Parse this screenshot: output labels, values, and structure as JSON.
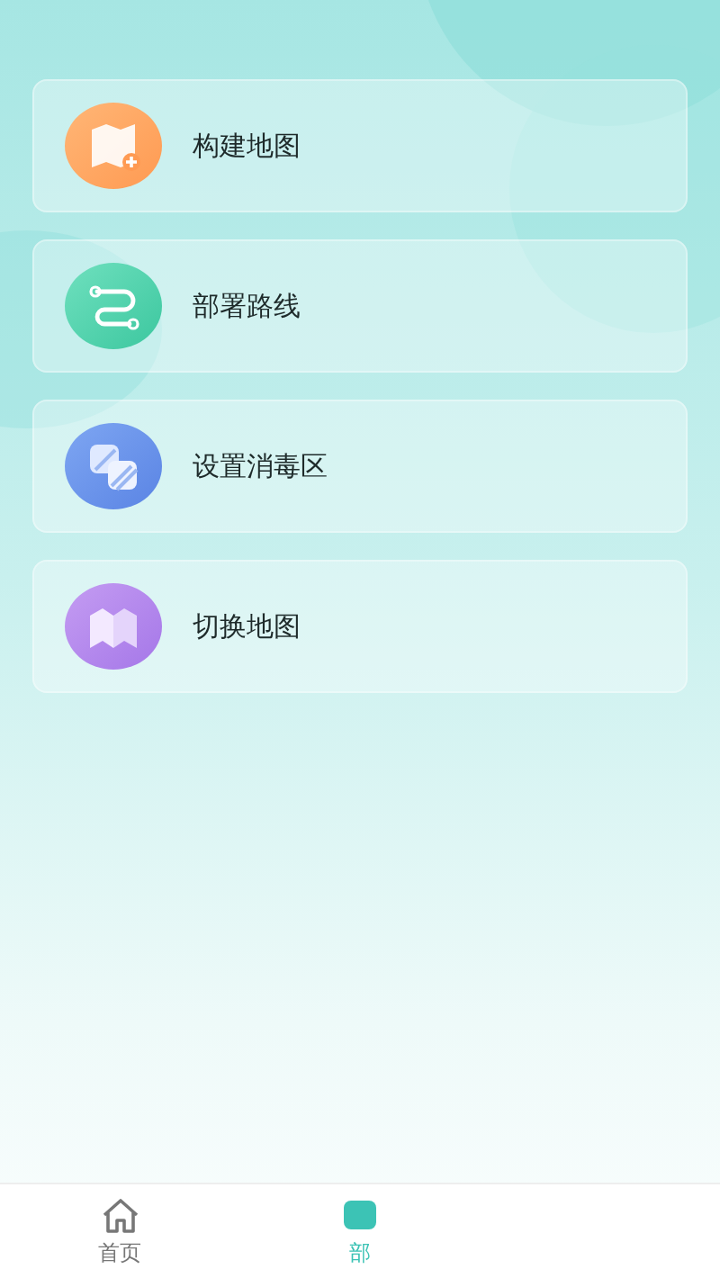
{
  "menu": [
    {
      "label": "构建地图",
      "kind": "build-map"
    },
    {
      "label": "部署路线",
      "kind": "route"
    },
    {
      "label": "设置消毒区",
      "kind": "zones"
    },
    {
      "label": "切换地图",
      "kind": "switch-map"
    }
  ],
  "tab_bar": [
    {
      "label": "首页",
      "kind": "home",
      "selected": false
    },
    {
      "label": "部",
      "kind": "deploy",
      "selected": true
    }
  ]
}
